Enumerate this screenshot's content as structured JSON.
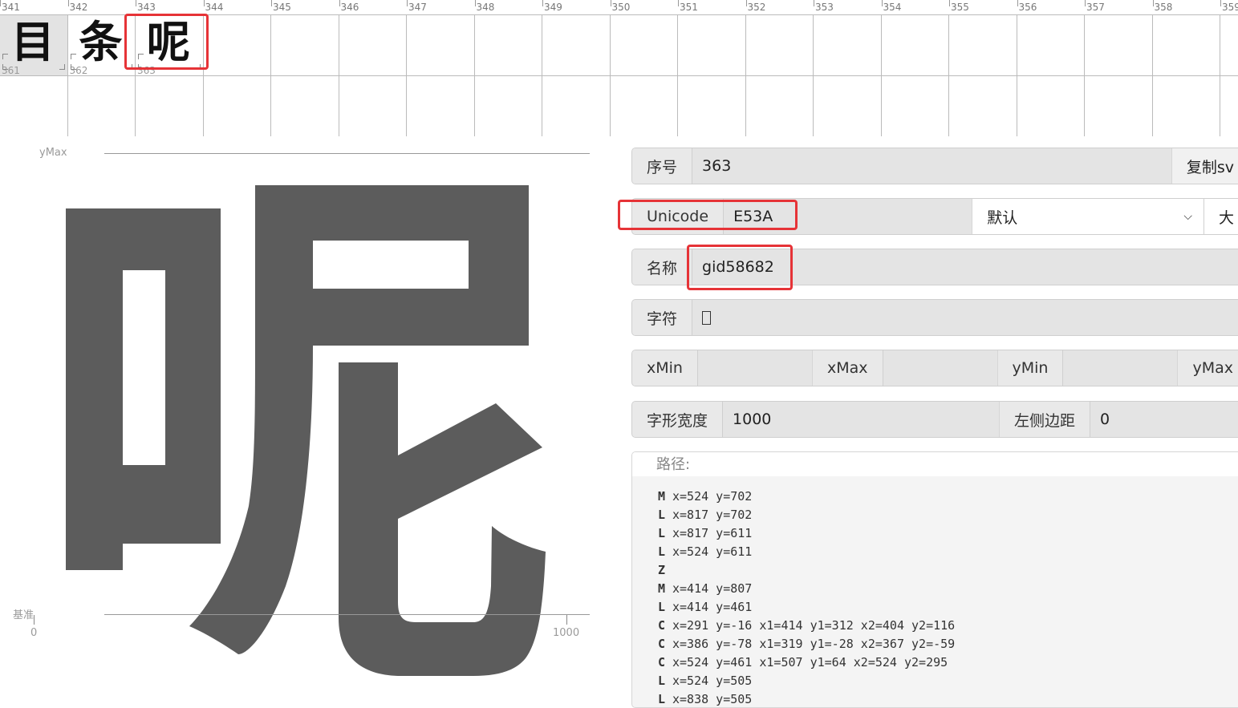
{
  "grid": {
    "ruler_numbers": [
      "341",
      "342",
      "343",
      "344",
      "345",
      "346",
      "347",
      "348",
      "349",
      "350",
      "351",
      "352",
      "353",
      "354",
      "355",
      "356",
      "357",
      "358",
      "359"
    ],
    "row1_cells": [
      {
        "glyph": "目",
        "number": "361",
        "selected": true
      },
      {
        "glyph": "条",
        "number": "362",
        "selected": false
      },
      {
        "glyph": "呢",
        "number": "363",
        "selected": false
      }
    ],
    "selected_glyph": "呢"
  },
  "editor": {
    "ymax_label": "yMax",
    "baseline_label": "基准",
    "origin_label": "0",
    "advance_label": "1000"
  },
  "panel": {
    "index_label": "序号",
    "index_value": "363",
    "copy_button": "复制sv",
    "unicode_label": "Unicode",
    "unicode_value": "E53A",
    "encoding_select": "默认",
    "extra_button": "大",
    "name_label": "名称",
    "name_value": "gid58682",
    "char_label": "字符",
    "char_value": "",
    "xmin_label": "xMin",
    "xmax_label": "xMax",
    "ymin_label": "yMin",
    "ymax_label": "yMax",
    "advance_label": "字形宽度",
    "advance_value": "1000",
    "lsb_label": "左侧边距",
    "lsb_value": "0",
    "path_label": "路径:"
  },
  "path_commands": [
    {
      "cmd": "M",
      "args": "x=524 y=702"
    },
    {
      "cmd": "L",
      "args": "x=817 y=702"
    },
    {
      "cmd": "L",
      "args": "x=817 y=611"
    },
    {
      "cmd": "L",
      "args": "x=524 y=611"
    },
    {
      "cmd": "Z",
      "args": ""
    },
    {
      "cmd": "M",
      "args": "x=414 y=807"
    },
    {
      "cmd": "L",
      "args": "x=414 y=461"
    },
    {
      "cmd": "C",
      "args": "x=291 y=-16 x1=414 y1=312 x2=404 y2=116"
    },
    {
      "cmd": "C",
      "args": "x=386 y=-78 x1=319 y1=-28 x2=367 y2=-59"
    },
    {
      "cmd": "C",
      "args": "x=524 y=461 x1=507 y1=64 x2=524 y2=295"
    },
    {
      "cmd": "L",
      "args": "x=524 y=505"
    },
    {
      "cmd": "L",
      "args": "x=838 y=505"
    }
  ],
  "colors": {
    "highlight": "#e63337",
    "glyph_fill": "#5c5c5c"
  }
}
